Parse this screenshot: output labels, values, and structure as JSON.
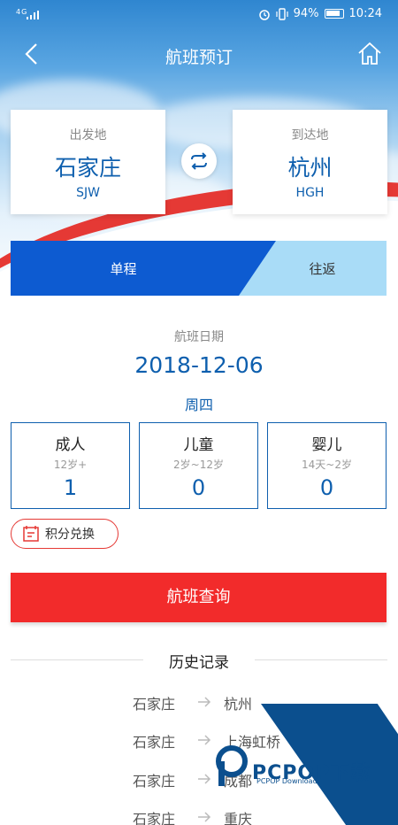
{
  "status_bar": {
    "network": "4G",
    "battery": "94%",
    "time": "10:24"
  },
  "nav": {
    "title": "航班预订"
  },
  "from": {
    "label": "出发地",
    "city": "石家庄",
    "code": "SJW"
  },
  "to": {
    "label": "到达地",
    "city": "杭州",
    "code": "HGH"
  },
  "trip_type": {
    "one_way": "单程",
    "round_trip": "往返",
    "selected": "单程"
  },
  "date": {
    "label": "航班日期",
    "value": "2018-12-06",
    "weekday": "周四"
  },
  "passengers": [
    {
      "name": "成人",
      "range": "12岁+",
      "count": "1"
    },
    {
      "name": "儿童",
      "range": "2岁~12岁",
      "count": "0"
    },
    {
      "name": "婴儿",
      "range": "14天~2岁",
      "count": "0"
    }
  ],
  "points_label": "积分兑换",
  "search_label": "航班查询",
  "history": {
    "title": "历史记录",
    "routes": [
      {
        "from": "石家庄",
        "to": "杭州"
      },
      {
        "from": "石家庄",
        "to": "上海虹桥"
      },
      {
        "from": "石家庄",
        "to": "成都"
      },
      {
        "from": "石家庄",
        "to": "重庆"
      }
    ]
  },
  "watermark": {
    "brand": "PCPOP下载",
    "sub": "PCPOP Download"
  },
  "colors": {
    "primary_blue": "#0e5fae",
    "tab_blue": "#0d5bd1",
    "accent_red": "#f22b2b"
  }
}
